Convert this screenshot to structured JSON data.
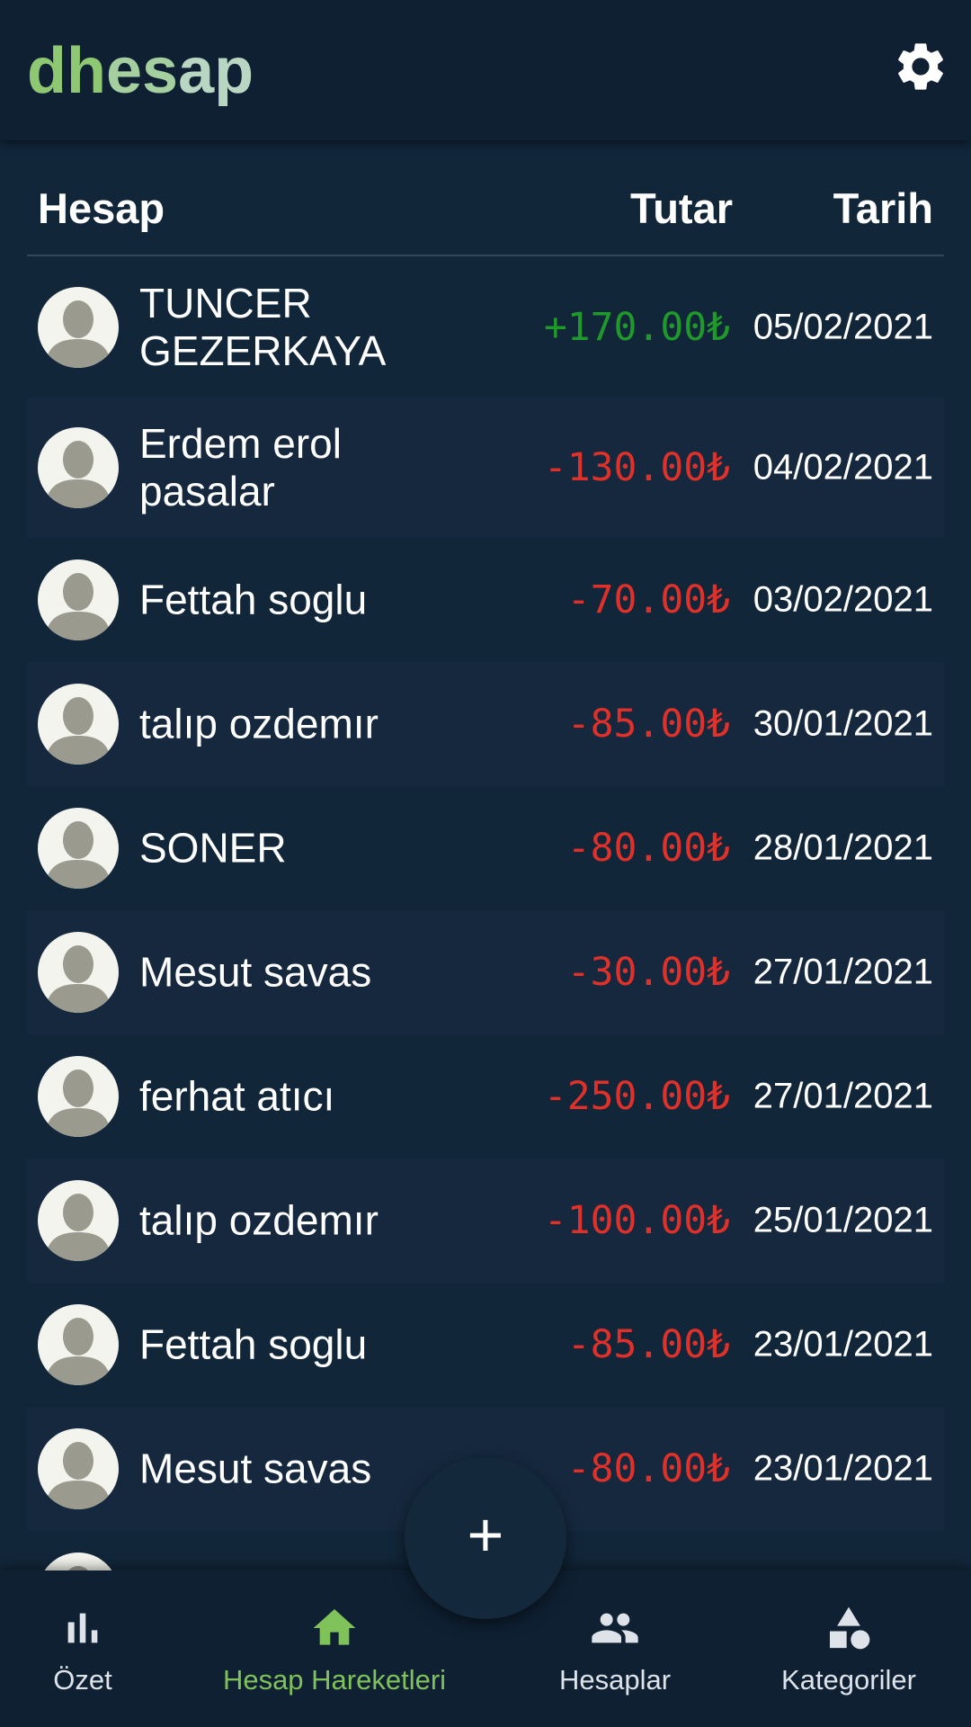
{
  "app": {
    "title_part1": "dh",
    "title_part2": "es",
    "title_part3": "ap",
    "settings_icon": "gear-icon"
  },
  "table": {
    "headers": {
      "account": "Hesap",
      "amount": "Tutar",
      "date": "Tarih"
    },
    "rows": [
      {
        "name": "TUNCER GEZERKAYA",
        "amount": "+170.00₺",
        "date": "05/02/2021",
        "sign": "positive"
      },
      {
        "name": "Erdem erol pasalar",
        "amount": "-130.00₺",
        "date": "04/02/2021",
        "sign": "negative"
      },
      {
        "name": "Fettah soglu",
        "amount": "-70.00₺",
        "date": "03/02/2021",
        "sign": "negative"
      },
      {
        "name": "talıp ozdemır",
        "amount": "-85.00₺",
        "date": "30/01/2021",
        "sign": "negative"
      },
      {
        "name": "SONER",
        "amount": "-80.00₺",
        "date": "28/01/2021",
        "sign": "negative"
      },
      {
        "name": "Mesut savas",
        "amount": "-30.00₺",
        "date": "27/01/2021",
        "sign": "negative"
      },
      {
        "name": "ferhat atıcı",
        "amount": "-250.00₺",
        "date": "27/01/2021",
        "sign": "negative"
      },
      {
        "name": "talıp ozdemır",
        "amount": "-100.00₺",
        "date": "25/01/2021",
        "sign": "negative"
      },
      {
        "name": "Fettah soglu",
        "amount": "-85.00₺",
        "date": "23/01/2021",
        "sign": "negative"
      },
      {
        "name": "Mesut savas",
        "amount": "-80.00₺",
        "date": "23/01/2021",
        "sign": "negative"
      }
    ]
  },
  "fab": {
    "label": "+"
  },
  "nav": {
    "items": [
      {
        "label": "Özet",
        "icon": "bar-chart-icon"
      },
      {
        "label": "Hesap Hareketleri",
        "icon": "home-icon",
        "active": true
      },
      {
        "label": "Hesaplar",
        "icon": "people-icon"
      },
      {
        "label": "Kategoriler",
        "icon": "shapes-icon"
      }
    ]
  },
  "colors": {
    "background": "#10202f",
    "appbar": "#0f2033",
    "positive": "#1f9a2a",
    "negative": "#e0302a",
    "active_nav": "#7fc25a",
    "logo": "#8fc872"
  }
}
